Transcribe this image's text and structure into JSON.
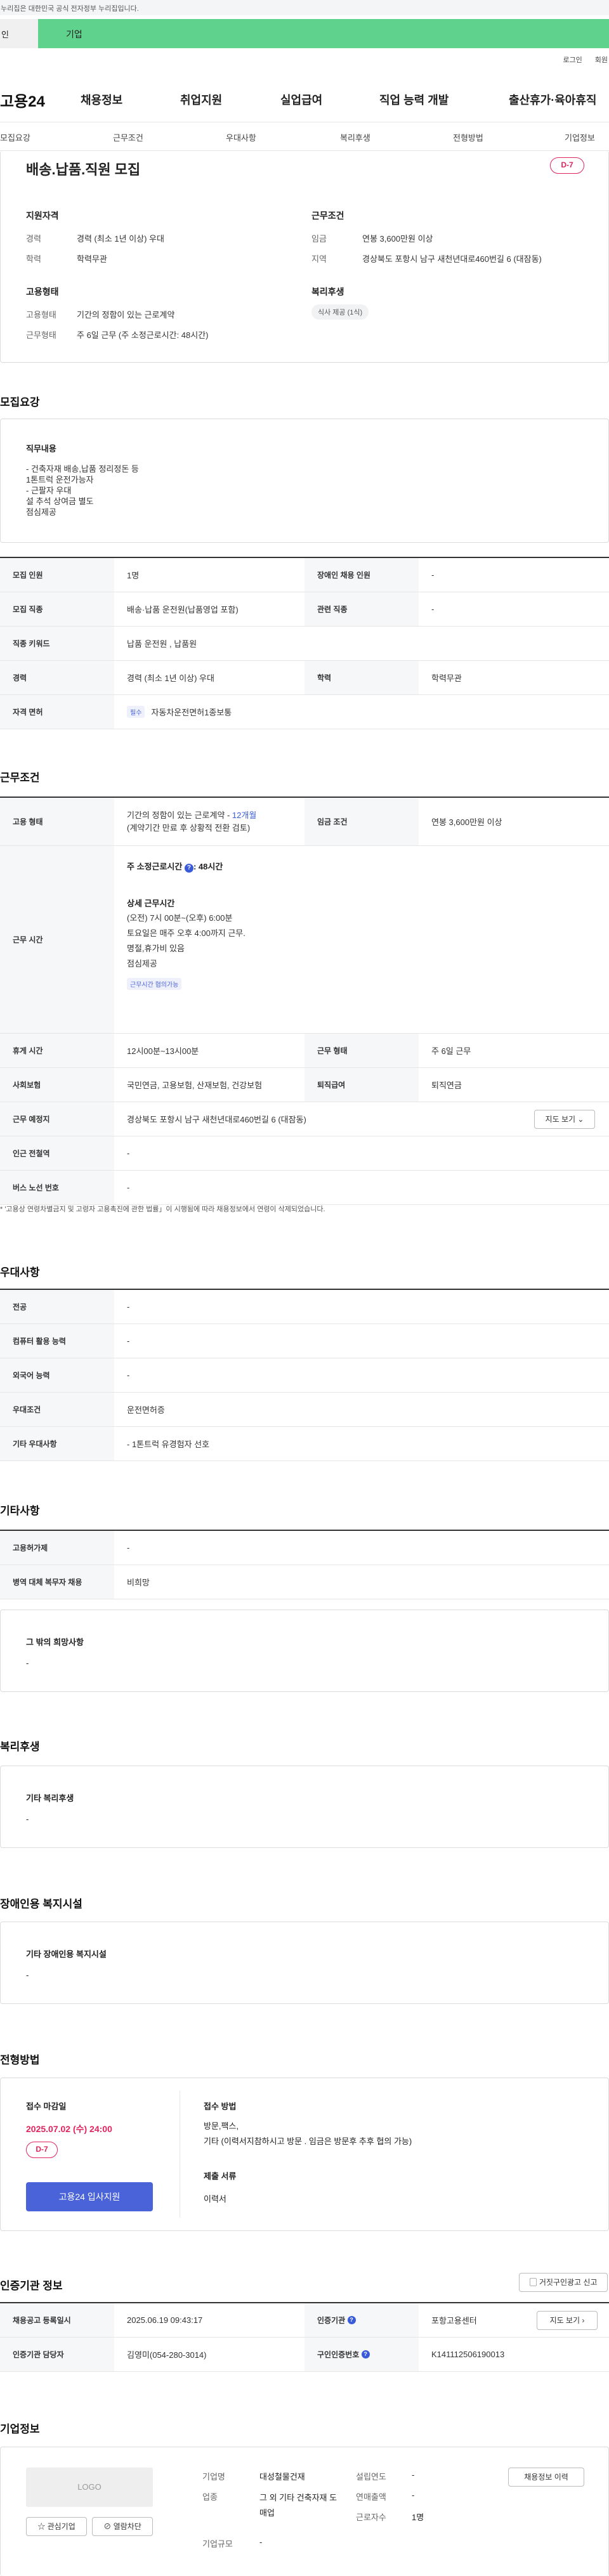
{
  "gov_banner": "이 누리집은 대한민국 공식 전자정부 누리집입니다.",
  "announce": {
    "left": "인",
    "text": "기업"
  },
  "top_links": [
    "로그인",
    "회원"
  ],
  "gnb": {
    "logo": "고용24",
    "menu": [
      "채용정보",
      "취업지원",
      "실업급여",
      "직업 능력 개발",
      "출산휴가·육아휴직"
    ]
  },
  "snb": [
    "모집요강",
    "근무조건",
    "우대사항",
    "복리후생",
    "전형방법",
    "기업정보"
  ],
  "job": {
    "title": "배송.납품.직원 모집",
    "dday": "D-7",
    "qual_h": "지원자격",
    "qual": [
      [
        "경력",
        "경력 (최소 1년 이상) 우대"
      ],
      [
        "학력",
        "학력무관"
      ]
    ],
    "cond_h": "근무조건",
    "cond": [
      [
        "임금",
        "연봉 3,600만원 이상"
      ],
      [
        "지역",
        "경상북도 포항시 남구 새천년대로460번길 6 (대잠동)"
      ]
    ],
    "emp_h": "고용형태",
    "emp": [
      [
        "고용형태",
        "기간의 정함이 있는 근로계약"
      ],
      [
        "근무형태",
        "주 6일 근무 (주 소정근로시간: 48시간)"
      ]
    ],
    "welfare_h": "복리후생",
    "welfare_chip": "식사 제공 (1식)"
  },
  "recruit": {
    "h": "모집요강",
    "duty_h": "직무내용",
    "duty": "- 건축자재 배송,납품 정리정돈  등\n   1톤트럭 운전가능자\n- 근팔자 우대\n   설 추석 상여금 별도\n   점심제공",
    "rows": [
      [
        "모집 인원",
        "1명",
        "장애인 채용 인원",
        "-"
      ],
      [
        "모집 직종",
        "배송·납품 운전원(납품영업 포함)",
        "관련 직종",
        "-"
      ],
      [
        "직종 키워드",
        "납품 운전원 , 납품원",
        "",
        ""
      ],
      [
        "경력",
        "경력 (최소 1년 이상) 우대",
        "학력",
        "학력무관"
      ],
      [
        "자격 면허",
        "자동차운전면허1종보통",
        "",
        ""
      ]
    ],
    "license_chip": "필수"
  },
  "work": {
    "h": "근무조건",
    "emp_label": "고용 형태",
    "emp_val_a": "기간의 정함이 있는 근로계약 - ",
    "emp_val_b": "12개월",
    "emp_val_c": "(계약기간 만료 후 상황적 전환 검토)",
    "wage_label": "임금 조건",
    "wage_val": "연봉 3,600만원 이상",
    "hours_label": "근무 시간",
    "hours_weekly": "주 소정근로시간",
    "hours_weekly_val": ": 48시간",
    "hours_detail_h": "상세 근무시간",
    "hours_detail": "(오전) 7시 00분~(오후) 6:00분\n토요일은 매주 오후 4:00까지 근무.\n명절,휴가비 있음\n점심제공",
    "hours_chip": "근무시간 협의가능",
    "rows": [
      [
        "휴게 시간",
        "12시00분~13시00분",
        "근무 형태",
        "주 6일 근무"
      ],
      [
        "사회보험",
        "국민연금, 고용보험, 산재보험, 건강보험",
        "퇴직급여",
        "퇴직연금"
      ],
      [
        "근무 예정지",
        "경상북도 포항시 남구 새천년대로460번길 6 (대잠동)",
        "",
        ""
      ],
      [
        "인근 전철역",
        "-",
        "",
        ""
      ],
      [
        "버스 노선 번호",
        "-",
        "",
        ""
      ]
    ],
    "map_btn": "지도 보기",
    "note": "* '고용상 연령차별금지 및 고령자 고용촉진에 관한 법률」이 시행됨에 따라 채용정보에서 연령이 삭제되었습니다."
  },
  "pref": {
    "h": "우대사항",
    "rows": [
      [
        "전공",
        "-"
      ],
      [
        "컴퓨터 활용 능력",
        "-"
      ],
      [
        "외국어 능력",
        "-"
      ],
      [
        "우대조건",
        "운전면허증"
      ],
      [
        "기타 우대사항",
        "- 1톤트럭 유경험자 선호"
      ]
    ]
  },
  "etc": {
    "h": "기타사항",
    "rows": [
      [
        "고용허가제",
        "-"
      ],
      [
        "병역 대체 복무자 채용",
        "비희망"
      ]
    ],
    "other_h": "그 밖의 희망사항",
    "other": "-"
  },
  "benefit": {
    "h": "복리후생",
    "sub": "기타 복리후생",
    "val": "-"
  },
  "disabled": {
    "h": "장애인용 복지시설",
    "sub": "기타 장애인용 복지시설",
    "val": "-"
  },
  "process": {
    "h": "전형방법",
    "deadline_h": "접수 마감일",
    "deadline": "2025.07.02 (수) 24:00",
    "dday": "D-7",
    "apply_btn": "고용24 입사지원",
    "method_h": "접수 방법",
    "method": "방문,팩스,\n기타 (이력서지참하시고 방문 . 임금은 방문후 추후 협의 가능)",
    "docs_h": "제출 서류",
    "docs": "이력서"
  },
  "cert": {
    "h": "인증기관 정보",
    "report_btn": "거짓구인광고 신고",
    "rows": [
      [
        "채용공고 등록일시",
        "2025.06.19 09:43:17",
        "인증기관",
        "포항고용센터"
      ],
      [
        "인증기관 담당자",
        "김영미(054-280-3014)",
        "구인인증번호",
        "K141112506190013"
      ]
    ],
    "map_btn": "지도 보기"
  },
  "company": {
    "h": "기업정보",
    "logo": "LOGO",
    "fav_btn": "관심기업",
    "block_btn": "열람차단",
    "history_btn": "채용정보 이력",
    "fields": [
      [
        "기업명",
        "대성철물건재"
      ],
      [
        "업종",
        "그 외 기타 건축자재 도매업"
      ],
      [
        "기업규모",
        "-"
      ],
      [
        "설립연도",
        "-"
      ],
      [
        "연매출액",
        "-"
      ],
      [
        "근로자수",
        "1명"
      ]
    ]
  }
}
